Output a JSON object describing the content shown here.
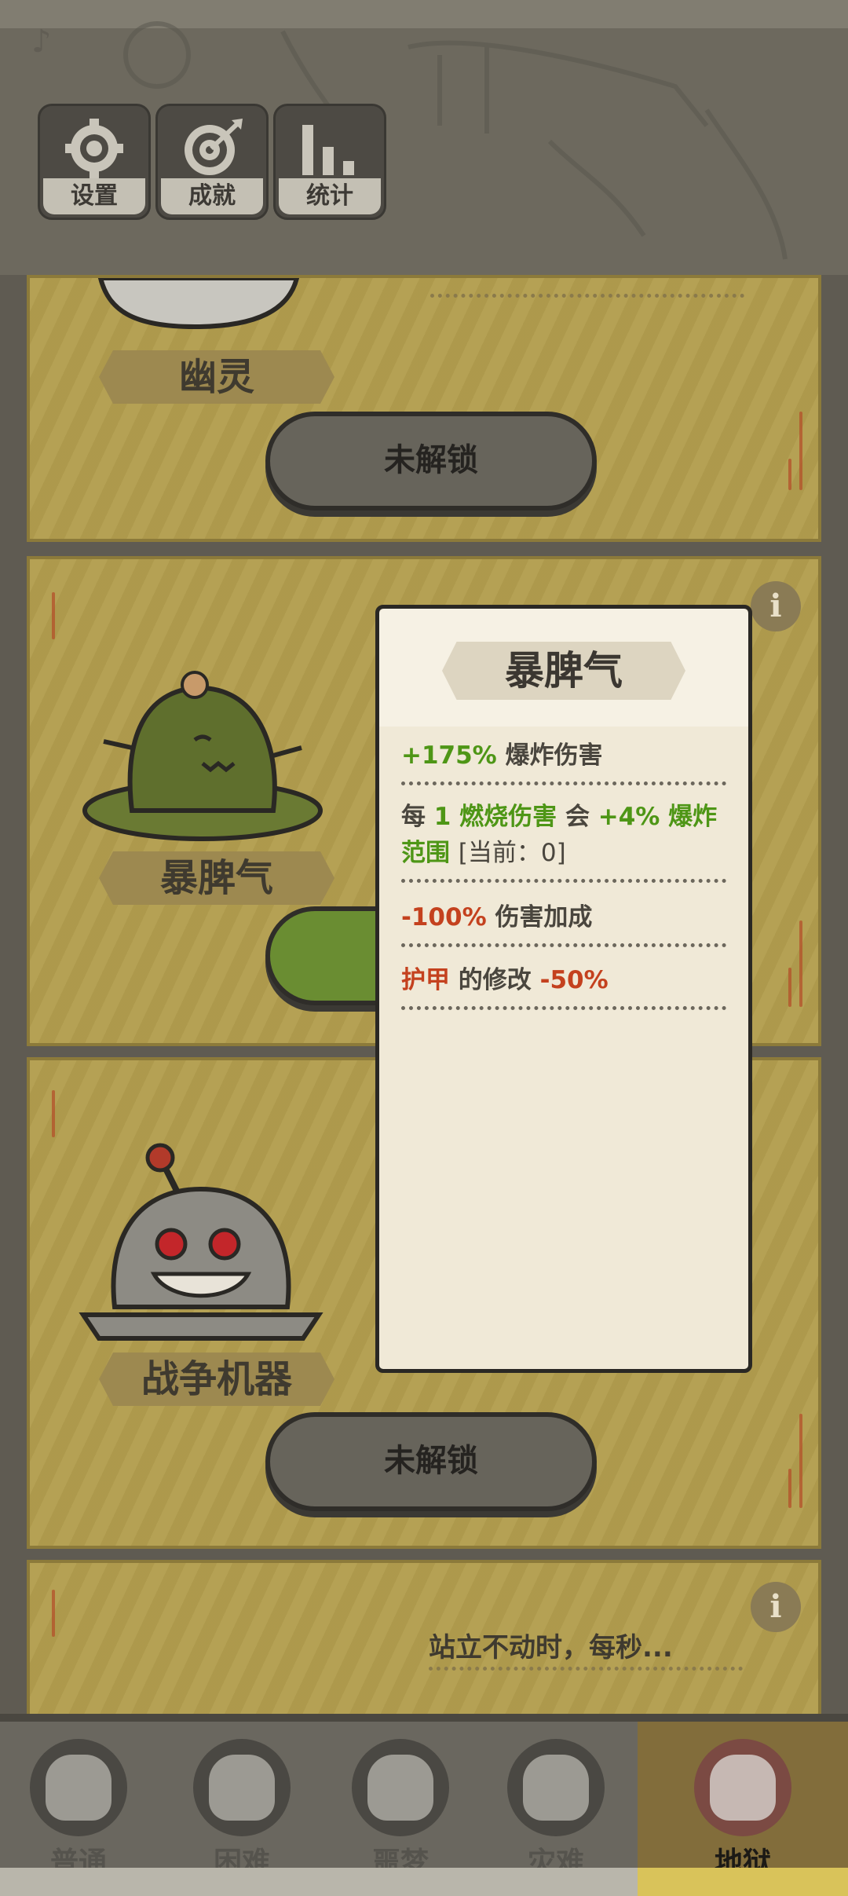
{
  "menu": {
    "settings": "设置",
    "achievements": "成就",
    "stats": "统计"
  },
  "cards": {
    "ghost": {
      "name": "幽灵",
      "button": "未解锁"
    },
    "grumpy": {
      "name": "暴脾气"
    },
    "war_machine": {
      "name": "战争机器",
      "button": "未解锁"
    },
    "next": {
      "desc": "站立不动时，每秒..."
    },
    "info_symbol": "i"
  },
  "popup": {
    "title": "暴脾气",
    "l1_value": "+175%",
    "l1_text": "爆炸伤害",
    "l2_a": "每",
    "l2_b": "1 燃烧伤害",
    "l2_c": "会",
    "l2_d": "+4% 爆炸",
    "l2_e": "范围",
    "l2_f": "[当前：0]",
    "l3_value": "-100%",
    "l3_text": "伤害加成",
    "l4_a": "护甲",
    "l4_b": "的修改",
    "l4_c": "-50%"
  },
  "tabs": [
    {
      "label": "普通"
    },
    {
      "label": "困难"
    },
    {
      "label": "噩梦"
    },
    {
      "label": "灾难"
    },
    {
      "label": "地狱"
    }
  ],
  "colors": {
    "positive": "#4e9616",
    "negative": "#c4411e",
    "card": "#b39e4e",
    "active_tab": "#826d3b"
  }
}
